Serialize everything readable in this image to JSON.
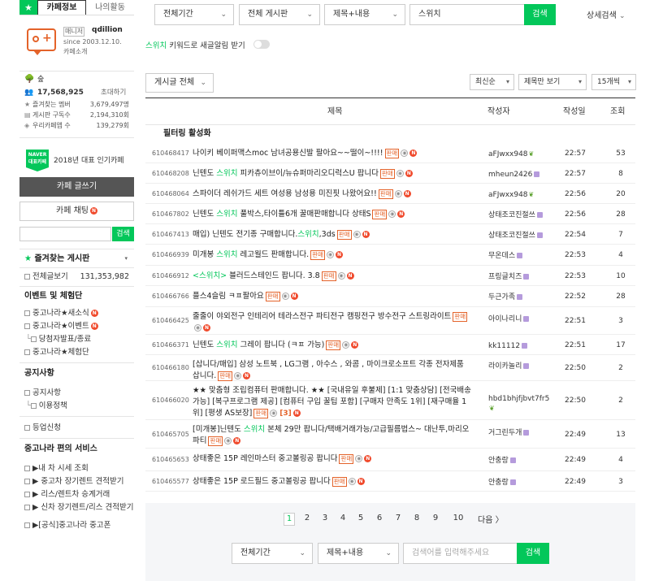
{
  "sidebar": {
    "tab_info": "카페정보",
    "tab_activity": "나의활동",
    "manager_badge": "매니저",
    "manager_name": "qdillion",
    "since": "since 2003.12.10.",
    "cafe_intro": "카페소개",
    "level_name": "숲",
    "member_count": "17,568,925",
    "invite": "초대하기",
    "stats": [
      {
        "label": "즐겨찾는 멤버",
        "value": "3,679,497명"
      },
      {
        "label": "게시판 구독수",
        "value": "2,194,310회"
      },
      {
        "label": "우리카페앱 수",
        "value": "139,279회"
      }
    ],
    "naver_badge": "NAVER 대표카페",
    "award_text": "2018년 대표 인기카페",
    "write_button": "카페 글쓰기",
    "chat_button": "카페 채팅",
    "search_button": "검색",
    "fav_board_title": "즐겨찾는 게시판",
    "all_posts_label": "전체글보기",
    "all_posts_count": "131,353,982",
    "event_title": "이벤트 및 체험단",
    "event_items": [
      "중고나라★새소식",
      "중고나라★이벤트",
      "당첨자발표/종료",
      "중고나라★체험단"
    ],
    "notice_title": "공지사항",
    "notice_items": [
      "공지사항",
      "이용정책"
    ],
    "upgrade": "등업신청",
    "service_title": "중고나라 편의 서비스",
    "service_items": [
      "▶내 차 시세 조회",
      "▶ 중고차 장기렌트 견적받기",
      "▶ 리스/렌트차 승계거래",
      "▶ 신차 장기렌트/리스 견적받기",
      "▶[공식]중고나라 중고폰"
    ]
  },
  "filters": {
    "period": "전체기간",
    "board": "전체 게시판",
    "scope": "제목+내용",
    "keyword": "스위치",
    "search_button": "검색",
    "detail_search": "상세검색",
    "keyword_alarm_keyword": "스위치",
    "keyword_alarm_text": "키워드로 새글알림 받기"
  },
  "list_controls": {
    "post_type": "게시글 전체",
    "sort": "최신순",
    "view_mode": "제목만 보기",
    "per_page": "15개씩"
  },
  "table": {
    "headers": {
      "title": "제목",
      "author": "작성자",
      "date": "작성일",
      "views": "조회"
    },
    "filter_label": "필터링 활성화",
    "rows": [
      {
        "num": "610468417",
        "pre": "나이키 베이퍼맥스moc 남녀공용신발 팔아요~~떨이~!!!!",
        "hl": "",
        "post": "",
        "author": "aFJwxx948",
        "author_icon": "sprout",
        "date": "22:57",
        "views": "53",
        "comments": ""
      },
      {
        "num": "610468208",
        "pre": "닌텐도 ",
        "hl": "스위치",
        "post": " 피카츄이브이/뉴슈퍼마리오디럭스U 팝니다",
        "author": "mheun2426",
        "author_icon": "level",
        "date": "22:57",
        "views": "8",
        "comments": ""
      },
      {
        "num": "610468064",
        "pre": "스파이더 레쉬가드 세트 여성용 남성용 미진핏 나왔어요!!",
        "hl": "",
        "post": "",
        "author": "aFJwxx948",
        "author_icon": "sprout",
        "date": "22:56",
        "views": "20",
        "comments": ""
      },
      {
        "num": "610467802",
        "pre": "닌텐도 ",
        "hl": "스위치",
        "post": " 풀박스,타이틀6개 꿀매판매합니다 상태S",
        "author": "상태조코진절쓰",
        "author_icon": "level",
        "date": "22:56",
        "views": "28",
        "comments": ""
      },
      {
        "num": "610467413",
        "pre": "매입) 닌텐도 전기종 구매합니다.",
        "hl": "스위치",
        "post": ",3ds",
        "author": "상태조코진절쓰",
        "author_icon": "level",
        "date": "22:54",
        "views": "7",
        "comments": ""
      },
      {
        "num": "610466939",
        "pre": "미개봉 ",
        "hl": "스위치",
        "post": " 레고월드 판매합니다.",
        "author": "무온데스",
        "author_icon": "level",
        "date": "22:53",
        "views": "4",
        "comments": ""
      },
      {
        "num": "610466912",
        "pre": "",
        "hl": "<스위치>",
        "post": " 블러드스테인드 팝니다. 3.8",
        "author": "프링글치즈",
        "author_icon": "level",
        "date": "22:53",
        "views": "10",
        "comments": ""
      },
      {
        "num": "610466766",
        "pre": "플스4슬림 ㅋㅍ팔아요",
        "hl": "",
        "post": "",
        "author": "두근가족",
        "author_icon": "level",
        "date": "22:52",
        "views": "28",
        "comments": ""
      },
      {
        "num": "610466425",
        "pre": "줄줄이 야외전구 인테리어 테라스전구 파티전구 캠핑전구 방수전구 스트링라이트",
        "hl": "",
        "post": "",
        "author": "아이나리니",
        "author_icon": "level",
        "date": "22:51",
        "views": "3",
        "comments": ""
      },
      {
        "num": "610466371",
        "pre": "닌텐도 ",
        "hl": "스위치",
        "post": " 그레이 팝니다 (ㅋㅍ 가능)",
        "author": "kk11112",
        "author_icon": "level",
        "date": "22:51",
        "views": "17",
        "comments": ""
      },
      {
        "num": "610466180",
        "pre": "[삽니다/매입] 삼성 노트북 , LG그램 , 아수스 , 와콤 , 마이크로소프트 각종 전자제품 삽니다.",
        "hl": "",
        "post": "",
        "author": "라이카놀리",
        "author_icon": "level",
        "date": "22:50",
        "views": "2",
        "comments": ""
      },
      {
        "num": "610466020",
        "pre": "★★ 맞춤형 조립컴퓨터 판매합니다. ★★ [국내유일 후불제] [1:1 맞춤상담] [전국배송가능] [복구프로그램 제공] [컴퓨터 구입 꿀팁 포함] [구매자 만족도 1위] [재구매율 1위] [평생 AS보장]",
        "hl": "",
        "post": "",
        "author": "hbd1bhjfjbvt7fr5",
        "author_icon": "sprout",
        "date": "22:50",
        "views": "2",
        "comments": "[3]"
      },
      {
        "num": "610465705",
        "pre": "[미개봉]닌텐도 ",
        "hl": "스위치",
        "post": " 본체 29만 팝니다/택배거래가능/고급필름법스~ 대난투,마리오파티",
        "author": "거그린두개",
        "author_icon": "level",
        "date": "22:49",
        "views": "13",
        "comments": ""
      },
      {
        "num": "610465653",
        "pre": "상태좋은 15P 레인마스터 중고볼링공 팝니다",
        "hl": "",
        "post": "",
        "author": "안충랑",
        "author_icon": "level",
        "date": "22:49",
        "views": "4",
        "comments": ""
      },
      {
        "num": "610465577",
        "pre": "상태좋은 15P 로드필드 중고볼링공 팝니다",
        "hl": "",
        "post": "",
        "author": "안충랑",
        "author_icon": "level",
        "date": "22:49",
        "views": "3",
        "comments": ""
      }
    ]
  },
  "sale_tag": "판매",
  "pagination": {
    "pages": [
      "1",
      "2",
      "3",
      "4",
      "5",
      "6",
      "7",
      "8",
      "9",
      "10"
    ],
    "current": "1",
    "next": "다음"
  },
  "bottom_search": {
    "period": "전체기간",
    "scope": "제목+내용",
    "placeholder": "검색어를 입력해주세요",
    "button": "검색"
  },
  "colors": {
    "accent": "#03c75a",
    "sale": "#e4632a",
    "new_badge": "#f04a2c"
  }
}
